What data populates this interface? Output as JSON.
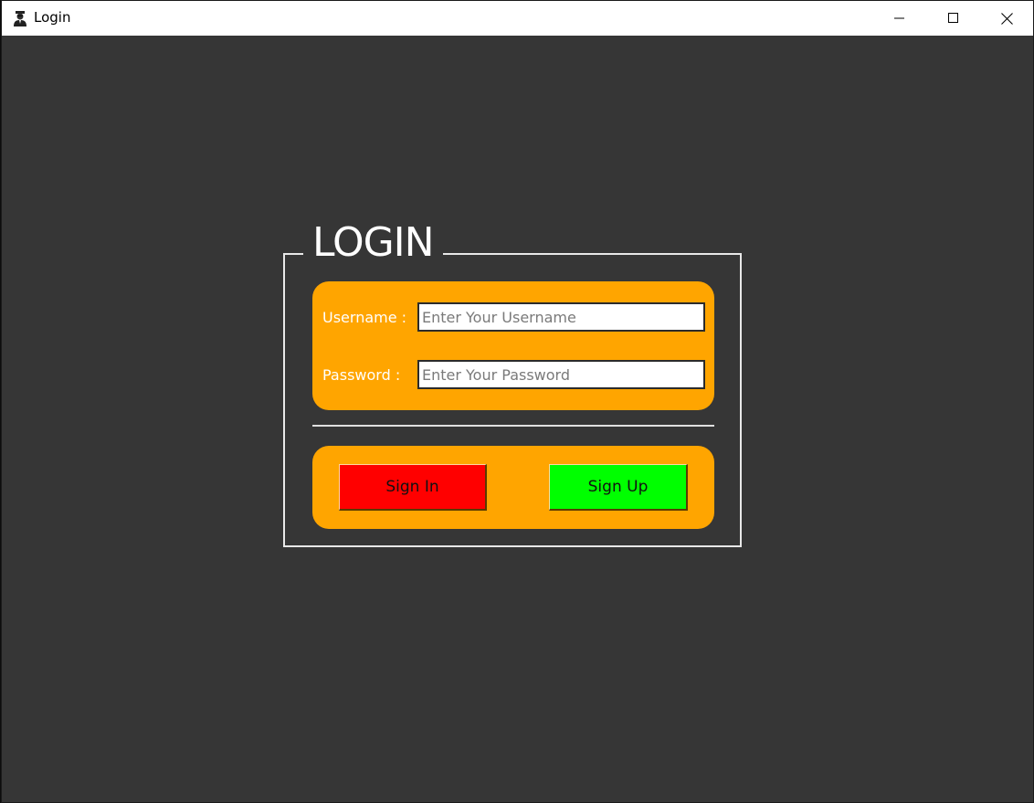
{
  "window": {
    "title": "Login",
    "icon": "user-avatar-icon"
  },
  "form": {
    "legend": "LOGIN",
    "username_label": "Username :",
    "username_placeholder": "Enter Your Username",
    "username_value": "",
    "password_label": "Password :",
    "password_placeholder": "Enter Your Password",
    "password_value": ""
  },
  "buttons": {
    "sign_in_label": "Sign In",
    "sign_up_label": "Sign Up"
  },
  "colors": {
    "background": "#363636",
    "panel": "#ffa500",
    "sign_in": "#ff0000",
    "sign_up": "#00ff00",
    "label_text": "#ffffff"
  }
}
